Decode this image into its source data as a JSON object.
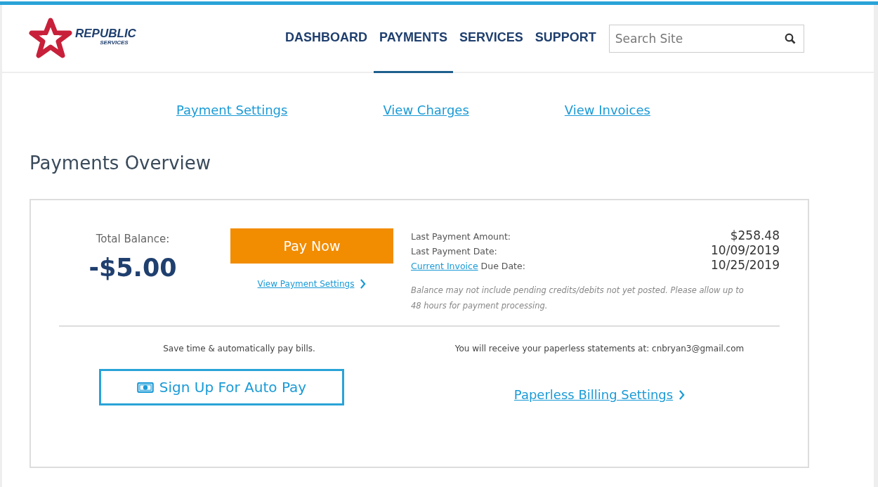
{
  "logo": {
    "name": "REPUBLIC",
    "subtitle": "SERVICES"
  },
  "nav": [
    {
      "label": "DASHBOARD",
      "selected": false
    },
    {
      "label": "PAYMENTS",
      "selected": true
    },
    {
      "label": "SERVICES",
      "selected": false
    },
    {
      "label": "SUPPORT",
      "selected": false
    }
  ],
  "search": {
    "placeholder": "Search Site"
  },
  "sub_links": [
    "Payment Settings",
    "View Charges",
    "View Invoices"
  ],
  "page_title": "Payments Overview",
  "balance": {
    "label": "Total Balance:",
    "amount": "-$5.00"
  },
  "pay_button": "Pay Now",
  "payment_settings_link": "View Payment Settings",
  "details": [
    {
      "label": "Last Payment Amount:",
      "value": "$258.48"
    },
    {
      "label": "Last Payment Date:",
      "value": "10/09/2019"
    },
    {
      "link": "Current Invoice",
      "label": "Due Date:",
      "value": "10/25/2019"
    }
  ],
  "note": "Balance may not include pending credits/debits not yet posted. Please allow up to 48 hours for payment processing.",
  "autopay": {
    "text": "Save time & automatically pay bills.",
    "button": "Sign Up For Auto Pay"
  },
  "paperless": {
    "text": "You will receive your paperless statements at: cnbryan3@gmail.com",
    "link": "Paperless Billing Settings"
  }
}
